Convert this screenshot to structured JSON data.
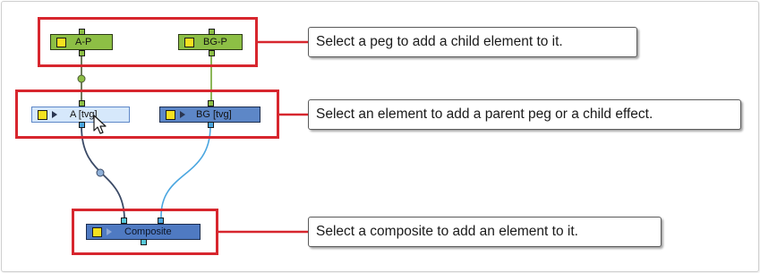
{
  "nodes": {
    "peg_a": "A-P",
    "peg_bg": "BG-P",
    "elem_a": "A  [tvg]",
    "elem_bg": "BG  [tvg]",
    "composite": "Composite"
  },
  "callouts": {
    "pegs": "Select a peg to add a child element to it.",
    "elements": "Select an element to add a parent peg or a child effect.",
    "composite": "Select a composite to add an element to it."
  },
  "colors": {
    "highlight": "#d7262e",
    "peg": "#8dbf45",
    "element": "#5d87c7",
    "selected_element": "#d6e8fb",
    "composite": "#4f7ac2",
    "wire_dark": "#3b4a66",
    "wire_light": "#4aa6e0"
  }
}
